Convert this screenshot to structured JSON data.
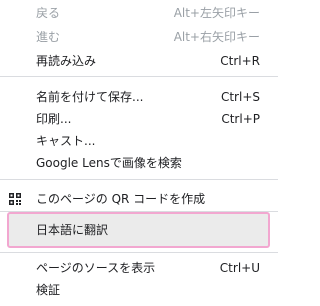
{
  "menu": {
    "items": {
      "back": {
        "label": "戻る",
        "shortcut": "Alt+左矢印キー"
      },
      "forward": {
        "label": "進む",
        "shortcut": "Alt+右矢印キー"
      },
      "reload": {
        "label": "再読み込み",
        "shortcut": "Ctrl+R"
      },
      "save_as": {
        "label": "名前を付けて保存...",
        "shortcut": "Ctrl+S"
      },
      "print": {
        "label": "印刷...",
        "shortcut": "Ctrl+P"
      },
      "cast": {
        "label": "キャスト..."
      },
      "google_lens": {
        "label": "Google Lensで画像を検索"
      },
      "qr_code": {
        "label": "このページの QR コードを作成",
        "icon": "qr-code-icon"
      },
      "translate": {
        "label": "日本語に翻訳"
      },
      "view_source": {
        "label": "ページのソースを表示",
        "shortcut": "Ctrl+U"
      },
      "inspect": {
        "label": "検証"
      }
    }
  },
  "colors": {
    "highlight_border": "#f2a7d0",
    "hover_background": "#ebebeb",
    "separator": "#dadce0",
    "disabled_text": "#9aa0a6"
  }
}
